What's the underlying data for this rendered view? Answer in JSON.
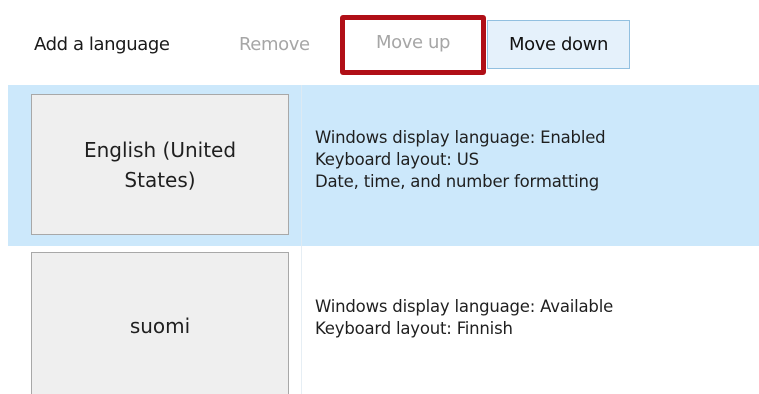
{
  "toolbar": {
    "add_label": "Add a language",
    "remove_label": "Remove",
    "move_up_label": "Move up",
    "move_down_label": "Move down"
  },
  "languages": [
    {
      "name": "English (United States)",
      "details": [
        "Windows display language: Enabled",
        "Keyboard layout: US",
        "Date, time, and number formatting"
      ]
    },
    {
      "name": "suomi",
      "details": [
        "Windows display language: Available",
        "Keyboard layout: Finnish"
      ]
    }
  ],
  "colors": {
    "selected_row": "#cce8fb",
    "highlight_box": "#b00f17",
    "move_down_bg": "#e5f1fb",
    "disabled_text": "#a6a6a6"
  }
}
